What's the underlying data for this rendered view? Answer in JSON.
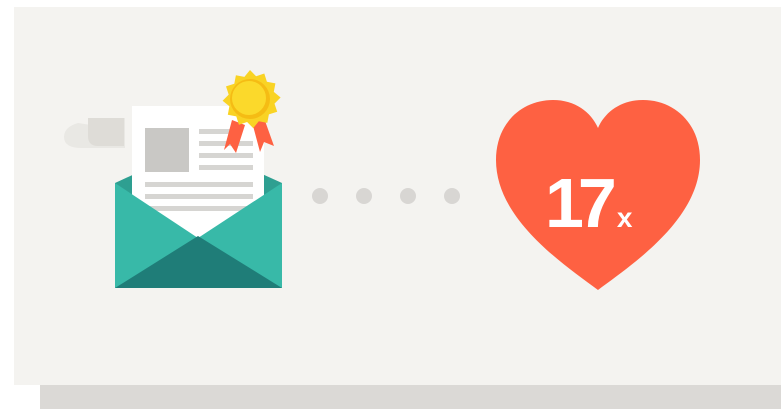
{
  "illustration": {
    "multiplier_value": "17",
    "multiplier_suffix": "x",
    "colors": {
      "background": "#f4f3f0",
      "envelope": "#38b9a8",
      "envelope_dark": "#1f7d78",
      "heart": "#fe6142",
      "seal": "#f9d324",
      "ribbon": "#fe6142",
      "dots": "#d8d6d3"
    },
    "icons": [
      "letter-with-seal-icon",
      "envelope-icon",
      "award-seal-icon",
      "heart-icon"
    ]
  }
}
